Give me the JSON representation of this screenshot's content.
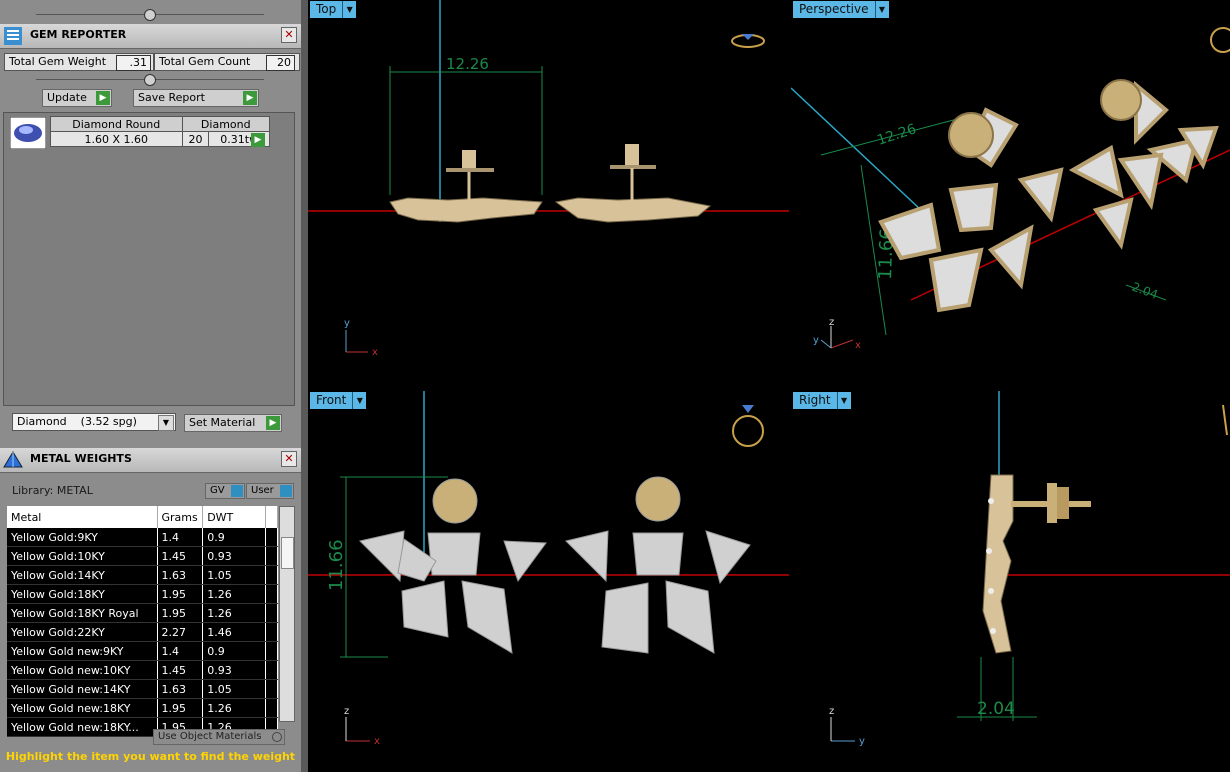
{
  "gem_reporter": {
    "title": "GEM REPORTER",
    "close": "✕",
    "total_weight_label": "Total Gem Weight",
    "total_weight_value": ".31",
    "total_count_label": "Total Gem Count",
    "total_count_value": "20",
    "update_label": "Update",
    "save_label": "Save Report",
    "gem": {
      "shape": "Diamond Round",
      "size": "1.60 X 1.60",
      "material": "Diamond",
      "count": "20",
      "weight": "0.31tw"
    },
    "material_select": "Diamond    (3.52 spg)",
    "set_material_label": "Set Material"
  },
  "metal_weights": {
    "title": "METAL WEIGHTS",
    "close": "✕",
    "library_label": "Library: METAL",
    "gv_label": "GV",
    "user_label": "User",
    "columns": [
      "Metal",
      "Grams",
      "DWT"
    ],
    "rows": [
      [
        "Yellow Gold:9KY",
        "1.4",
        "0.9"
      ],
      [
        "Yellow Gold:10KY",
        "1.45",
        "0.93"
      ],
      [
        "Yellow Gold:14KY",
        "1.63",
        "1.05"
      ],
      [
        "Yellow Gold:18KY",
        "1.95",
        "1.26"
      ],
      [
        "Yellow Gold:18KY Royal",
        "1.95",
        "1.26"
      ],
      [
        "Yellow Gold:22KY",
        "2.27",
        "1.46"
      ],
      [
        "Yellow Gold new:9KY",
        "1.4",
        "0.9"
      ],
      [
        "Yellow Gold new:10KY",
        "1.45",
        "0.93"
      ],
      [
        "Yellow Gold new:14KY",
        "1.63",
        "1.05"
      ],
      [
        "Yellow Gold new:18KY",
        "1.95",
        "1.26"
      ],
      [
        "Yellow Gold new:18KY...",
        "1.95",
        "1.26"
      ]
    ],
    "use_object_materials": "Use Object Materials",
    "hint": "Highlight the item you want to find the weight"
  },
  "viewports": {
    "top": {
      "label": "Top",
      "dim": "12.26"
    },
    "perspective": {
      "label": "Perspective",
      "dim_a": "12.26",
      "dim_b": "11.66",
      "dim_c": "2.04"
    },
    "front": {
      "label": "Front",
      "dim": "11.66"
    },
    "right": {
      "label": "Right",
      "dim": "2.04"
    }
  },
  "axes": {
    "x": "x",
    "y": "y",
    "z": "z"
  },
  "colors": {
    "viewport_tab": "#5ab7e6",
    "dim_line": "#1a8a4a",
    "metal": "#d8c29a",
    "axis_red": "#c00000",
    "grid_cyan": "#2aa7c6"
  }
}
